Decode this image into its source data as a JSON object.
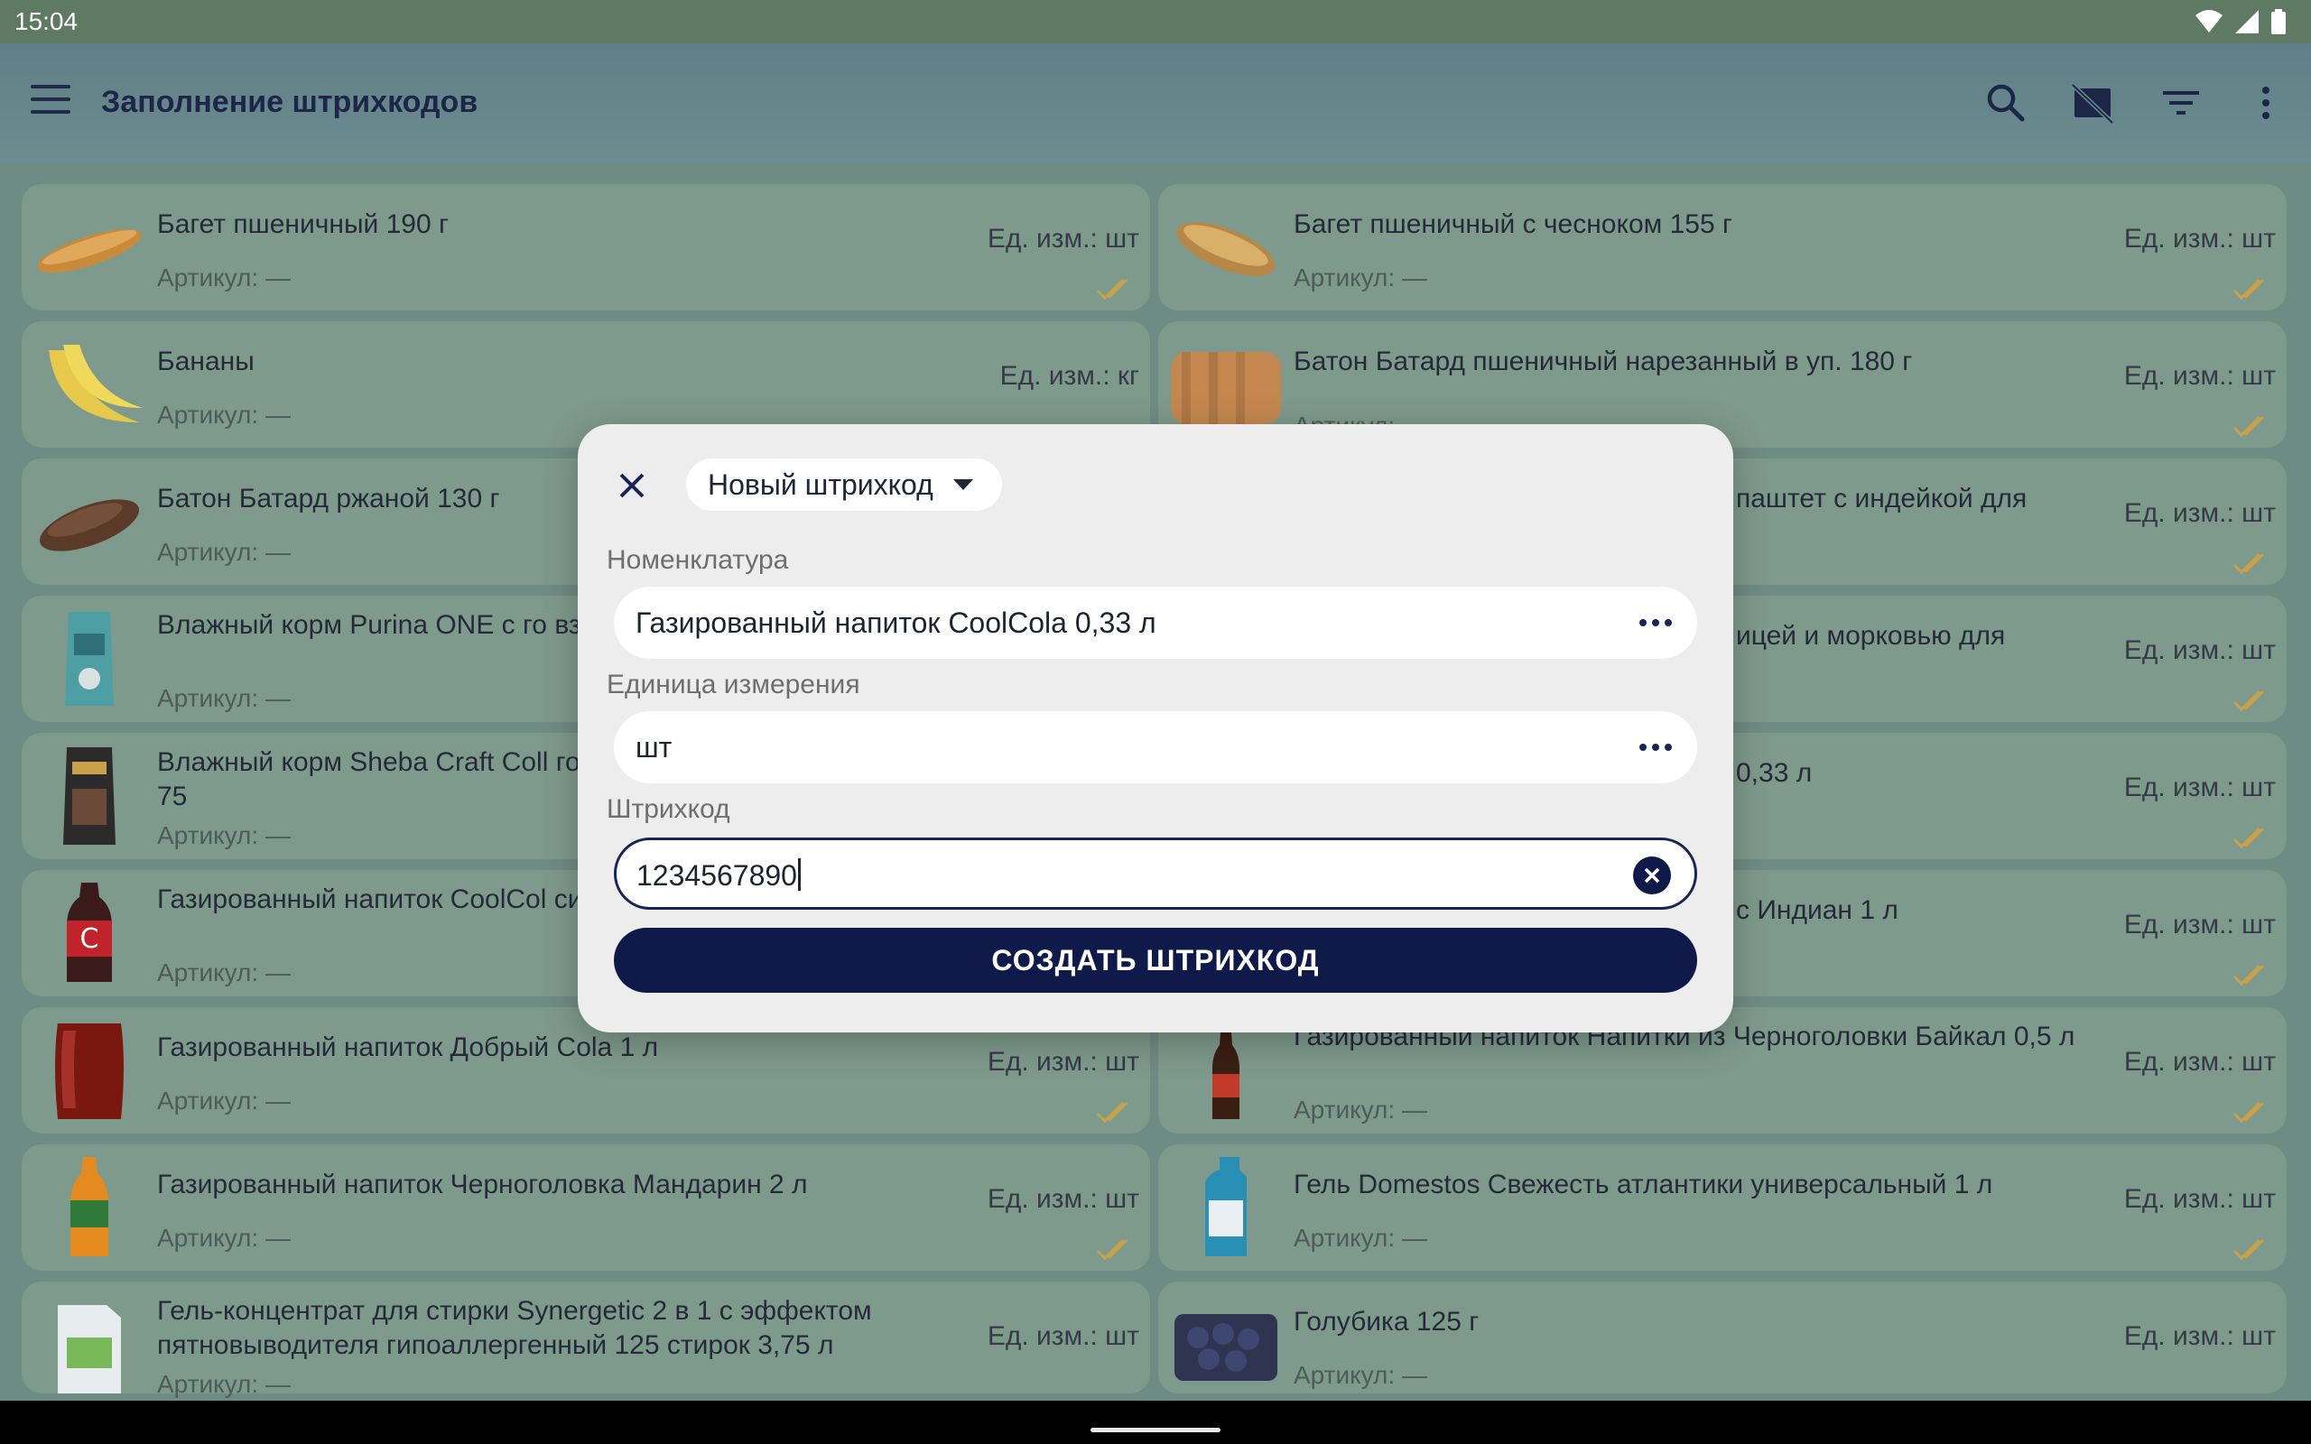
{
  "status_bar": {
    "time": "15:04",
    "icons": [
      "wifi-icon",
      "signal-icon",
      "battery-icon"
    ]
  },
  "app_bar": {
    "title": "Заполнение штрихкодов",
    "icons": [
      "menu-icon",
      "search-icon",
      "no-image-icon",
      "filter-icon",
      "more-vert-icon"
    ]
  },
  "colors": {
    "accent": "#0f1a4a",
    "dialog_bg": "#ededed",
    "check": "#c8a24a"
  },
  "products": [
    {
      "name": "Багет пшеничный 190 г",
      "article": "Артикул: —",
      "unit": "Ед. изм.: шт",
      "thumb": "baguette"
    },
    {
      "name": "Багет пшеничный с чесноком 155 г",
      "article": "Артикул: —",
      "unit": "Ед. изм.: шт",
      "thumb": "baguette-garlic"
    },
    {
      "name": "Бананы",
      "article": "Артикул: —",
      "unit": "Ед. изм.: кг",
      "thumb": "bananas"
    },
    {
      "name": "Батон Батард пшеничный нарезанный в уп. 180 г",
      "article": "Артикул: —",
      "unit": "Ед. изм.: шт",
      "thumb": "bread-sliced"
    },
    {
      "name": "Батон Батард ржаной 130 г",
      "article": "Артикул: —",
      "unit": "Ед. изм.: шт",
      "thumb": "rye-bread"
    },
    {
      "name": "паштет с индейкой для",
      "article": "",
      "unit": "Ед. изм.: шт",
      "thumb": "none"
    },
    {
      "name": "Влажный корм Purina ONE с го взрослых кошек 75 г",
      "article": "Артикул: —",
      "unit": "",
      "thumb": "cat-food-purina"
    },
    {
      "name": "ицей и морковью для",
      "article": "",
      "unit": "Ед. изм.: шт",
      "thumb": "none"
    },
    {
      "name": "Влажный корм Sheba Craft Coll говядина в соусе для кошек 75",
      "article": "Артикул: —",
      "unit": "",
      "thumb": "cat-food-sheba"
    },
    {
      "name": "0,33 л",
      "article": "",
      "unit": "Ед. изм.: шт",
      "thumb": "none"
    },
    {
      "name": "Газированный напиток CoolCol сильногазированный 1,5 л",
      "article": "Артикул: —",
      "unit": "",
      "thumb": "cola-bottle"
    },
    {
      "name": "с Индиан 1 л",
      "article": "",
      "unit": "Ед. изм.: шт",
      "thumb": "none"
    },
    {
      "name": "Газированный напиток Добрый Cola 1 л",
      "article": "Артикул: —",
      "unit": "Ед. изм.: шт",
      "thumb": "cola-dobry"
    },
    {
      "name": "Газированный напиток Напитки из Черноголовки Байкал 0,5 л",
      "article": "Артикул: —",
      "unit": "Ед. изм.: шт",
      "thumb": "baikal-bottle"
    },
    {
      "name": "Газированный напиток Черноголовка Мандарин 2 л",
      "article": "Артикул: —",
      "unit": "Ед. изм.: шт",
      "thumb": "mandarin-bottle"
    },
    {
      "name": "Гель Domestos Свежесть атлантики универсальный 1 л",
      "article": "Артикул: —",
      "unit": "Ед. изм.: шт",
      "thumb": "domestos"
    },
    {
      "name": "Гель-концентрат для стирки Synergetic 2 в 1 с эффектом пятновыводителя гипоаллергенный 125 стирок 3,75 л",
      "article": "Артикул: —",
      "unit": "Ед. изм.: шт",
      "thumb": "synergetic"
    },
    {
      "name": "Голубика 125 г",
      "article": "Артикул: —",
      "unit": "Ед. изм.: шт",
      "thumb": "blueberries"
    }
  ],
  "overflow_text": {
    "article_peek": "Артикул: —"
  },
  "dialog": {
    "type_selector": "Новый штрихкод",
    "nomenclature_label": "Номенклатура",
    "nomenclature_value": "Газированный напиток CoolCola 0,33 л",
    "unit_label": "Единица измерения",
    "unit_value": "шт",
    "barcode_label": "Штрихкод",
    "barcode_value": "1234567890",
    "create_button": "СОЗДАТЬ ШТРИХКОД"
  }
}
